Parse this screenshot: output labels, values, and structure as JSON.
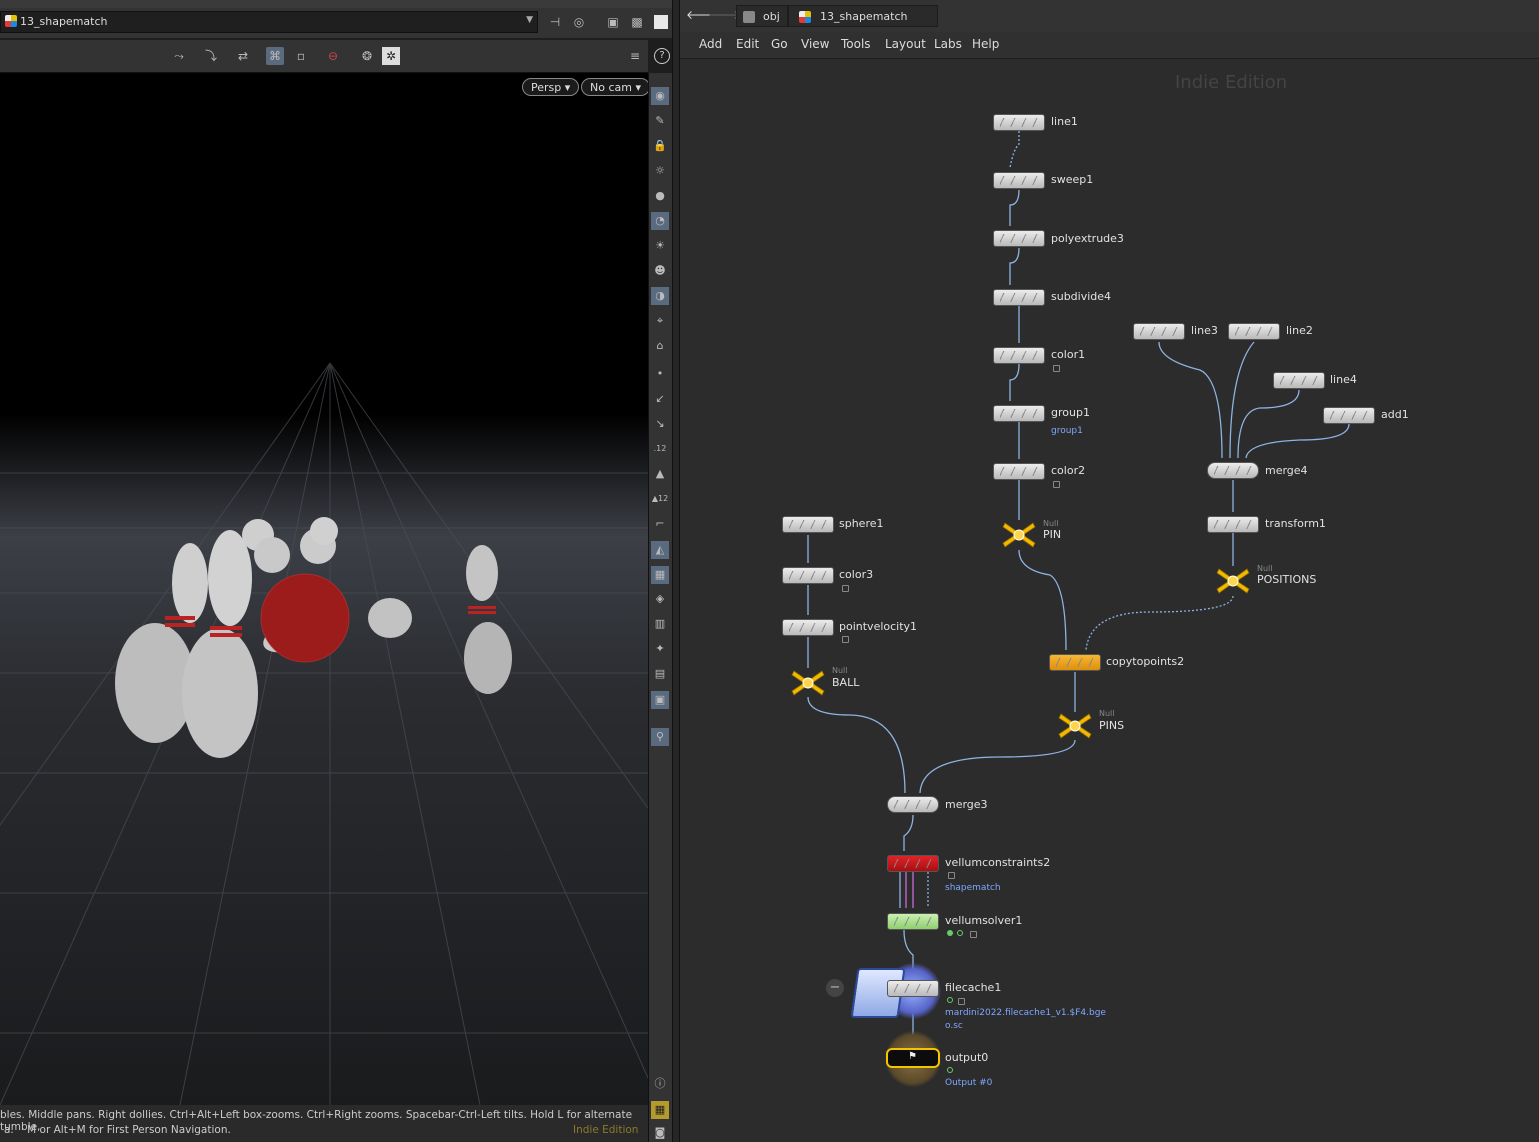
{
  "scene_viewer": {
    "path": "13_shapematch",
    "camera_persp": "Persp",
    "camera_nocam": "No cam",
    "status_line1": "bles. Middle pans. Right dollies. Ctrl+Alt+Left box-zooms. Ctrl+Right zooms. Spacebar-Ctrl-Left tilts. Hold L for alternate tumble,",
    "status_line2": "a.    M or Alt+M for First Person Navigation.",
    "indie_label": "Indie Edition"
  },
  "network_editor": {
    "breadcrumbs": [
      "obj",
      "13_shapematch"
    ],
    "menu": [
      "Add",
      "Edit",
      "Go",
      "View",
      "Tools",
      "Layout",
      "Labs",
      "Help"
    ],
    "watermark": "Indie Edition",
    "nodes": {
      "line1": "line1",
      "sweep1": "sweep1",
      "polyextrude3": "polyextrude3",
      "subdivide4": "subdivide4",
      "color1": "color1",
      "group1": "group1",
      "group1_sub": "group1",
      "color2": "color2",
      "pin": "PIN",
      "line3": "line3",
      "line2": "line2",
      "line4": "line4",
      "add1": "add1",
      "merge4": "merge4",
      "transform1": "transform1",
      "positions": "POSITIONS",
      "sphere1": "sphere1",
      "color3": "color3",
      "pointvelocity1": "pointvelocity1",
      "ball": "BALL",
      "copytopoints2": "copytopoints2",
      "pins": "PINS",
      "merge3": "merge3",
      "vellumconstraints2": "vellumconstraints2",
      "vellumconstraints2_sub": "shapematch",
      "vellumsolver1": "vellumsolver1",
      "filecache1": "filecache1",
      "filecache1_sub1": "mardini2022.filecache1_v1.$F4.bge",
      "filecache1_sub2": "o.sc",
      "output0": "output0",
      "output0_sub": "Output #0",
      "null_type": "Null"
    }
  },
  "colors": {
    "null_yellow": "#f5b800",
    "vellumconstraints_red": "#c8161b",
    "vellumsolver_green": "#b8e6a0",
    "copytopoints_orange": "#f2a218",
    "wire": "#8db3e2",
    "subtext_blue": "#7fa7ff"
  }
}
